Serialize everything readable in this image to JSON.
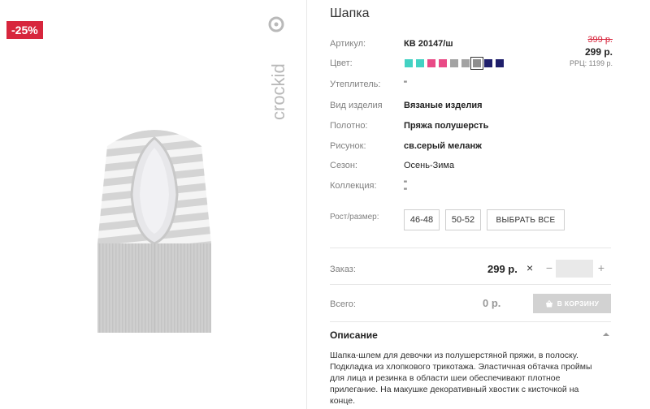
{
  "badge": {
    "discount": "-25%"
  },
  "brand": {
    "logo_text": "crockid",
    "icon": "brand-logo"
  },
  "product": {
    "title": "Шапка",
    "image_icon": "knit-hat-photo"
  },
  "attributes": {
    "article": {
      "label": "Артикул:",
      "value": "КВ 20147/ш"
    },
    "color": {
      "label": "Цвет:"
    },
    "insulation": {
      "label": "Утеплитель:",
      "value": "\""
    },
    "type": {
      "label": "Вид изделия",
      "value": "Вязаные изделия"
    },
    "fabric": {
      "label": "Полотно:",
      "value": "Пряжа полушерсть"
    },
    "pattern": {
      "label": "Рисунок:",
      "value": "св.серый меланж"
    },
    "season": {
      "label": "Сезон:",
      "value": "Осень-Зима"
    },
    "collection": {
      "label": "Коллекция:",
      "value": "\"",
      "value2": "\""
    }
  },
  "colors": {
    "swatches": [
      "#43d2c3",
      "#43d2c3",
      "#e94a86",
      "#e94a86",
      "#a3a3a3",
      "#a3a3a3",
      "#8f8f8f",
      "#1f1f6b",
      "#1f1f6b"
    ],
    "selected_index": 6
  },
  "price": {
    "old": "399 р.",
    "current": "299 р.",
    "rrp": "РРЦ: 1199 р."
  },
  "sizes": {
    "label": "Рост/размер:",
    "options": [
      "46-48",
      "50-52"
    ],
    "select_all": "ВЫБРАТЬ ВСЕ"
  },
  "order": {
    "label": "Заказ:",
    "price": "299 р.",
    "times": "×",
    "minus": "−",
    "plus": "+",
    "quantity": ""
  },
  "total": {
    "label": "Всего:",
    "value": "0 р.",
    "cart_button": "В КОРЗИНУ",
    "cart_icon": "basket-icon"
  },
  "description": {
    "heading": "Описание",
    "toggle_icon": "chevron-up-icon",
    "text": "Шапка-шлем для девочки из полушерстяной пряжи, в полоску. Подкладка из хлопкового трикотажа. Эластичная обтачка проймы для лица и резинка в области шеи обеспечивают плотное прилегание. На макушке декоративный хвостик с кисточкой на конце."
  },
  "accent_colors": {
    "sale": "#d7263d",
    "muted": "#808080"
  }
}
